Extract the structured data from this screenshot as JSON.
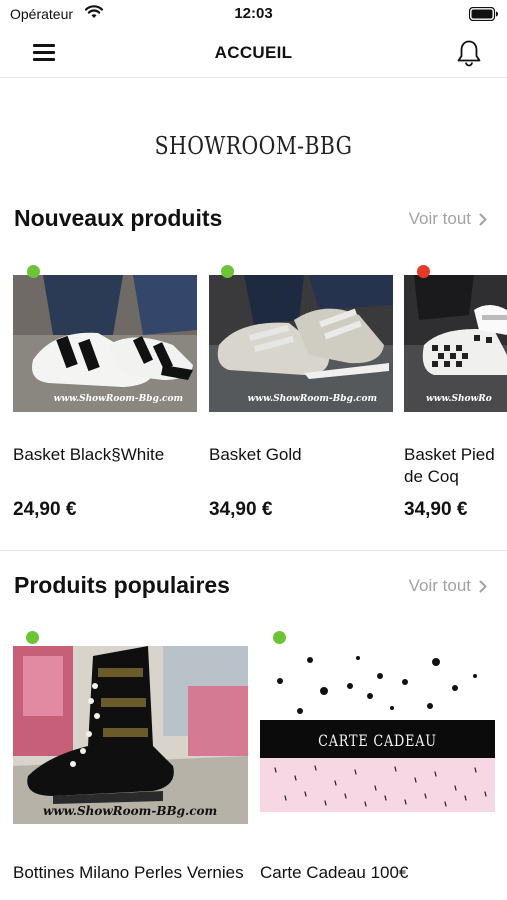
{
  "status_bar": {
    "carrier": "Opérateur",
    "time": "12:03"
  },
  "nav": {
    "title": "ACCUEIL"
  },
  "brand": {
    "name": "SHOWROOM-BBG"
  },
  "new_products": {
    "title": "Nouveaux produits",
    "see_all": "Voir tout",
    "items": [
      {
        "name": "Basket Black§White",
        "price": "24,90 €",
        "watermark": "www.ShowRoom-Bbg.com",
        "dot_color": "#6cc436"
      },
      {
        "name": "Basket Gold",
        "price": "34,90 €",
        "watermark": "www.ShowRoom-Bbg.com",
        "dot_color": "#6cc436"
      },
      {
        "name": "Basket Pied de Coq",
        "price": "34,90 €",
        "watermark": "www.ShowRo",
        "dot_color": "#e53a2a"
      }
    ]
  },
  "popular_products": {
    "title": "Produits populaires",
    "see_all": "Voir tout",
    "items": [
      {
        "name": "Bottines Milano Perles Vernies",
        "watermark": "www.ShowRoom-BBg.com",
        "dot_color": "#6cc436"
      },
      {
        "name": "Carte Cadeau 100€",
        "banner": "CARTE CADEAU",
        "dot_color": "#6cc436"
      }
    ]
  }
}
